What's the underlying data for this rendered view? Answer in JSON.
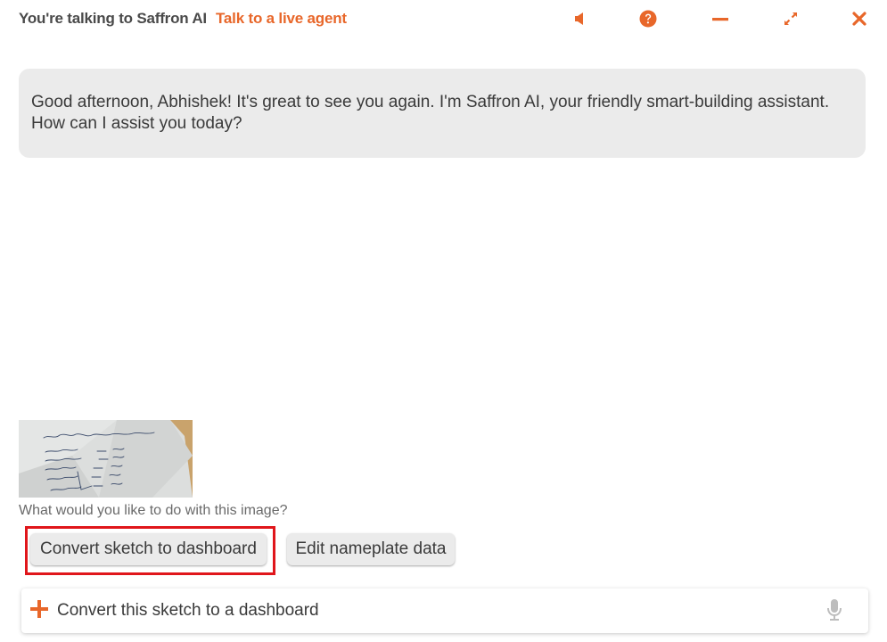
{
  "header": {
    "title": "You're talking to Saffron AI",
    "live_agent_link": "Talk to a live agent",
    "icons": [
      "speaker-icon",
      "help-icon",
      "minimize-icon",
      "expand-icon",
      "close-icon"
    ]
  },
  "messages": [
    {
      "role": "assistant",
      "text": "Good afternoon, Abhishek! It's great to see you again. I'm Saffron AI, your friendly smart-building assistant. How can I assist you today?"
    }
  ],
  "attachment": {
    "kind": "image",
    "description_icon": "handwritten-sketch-thumbnail",
    "caption": "What would you like to do with this image?"
  },
  "suggestions": [
    {
      "label": "Convert sketch to dashboard",
      "highlighted": true
    },
    {
      "label": "Edit nameplate data",
      "highlighted": false
    }
  ],
  "composer": {
    "value": "Convert this sketch to a dashboard",
    "attach_icon": "plus-icon",
    "mic_icon": "microphone-icon"
  },
  "colors": {
    "accent": "#e8672a",
    "bubble": "#ebebeb",
    "highlight": "#e0161b"
  }
}
